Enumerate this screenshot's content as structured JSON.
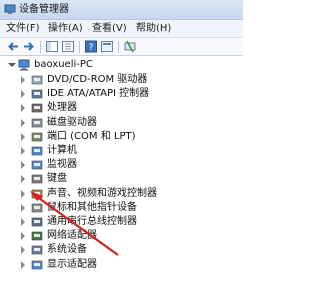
{
  "window": {
    "title": "设备管理器"
  },
  "menu": [
    {
      "label": "文件(F)"
    },
    {
      "label": "操作(A)"
    },
    {
      "label": "查看(V)"
    },
    {
      "label": "帮助(H)"
    }
  ],
  "toolbar": {
    "buttons": [
      "back-icon",
      "forward-icon",
      "show-hide-icon",
      "console-tree-icon",
      "help-icon",
      "properties-icon",
      "update-driver-icon"
    ]
  },
  "tree": {
    "root": "baoxueli-PC",
    "items": [
      {
        "label": "DVD/CD-ROM 驱动器",
        "icon": "dvd-drive-icon"
      },
      {
        "label": "IDE ATA/ATAPI 控制器",
        "icon": "ide-controller-icon"
      },
      {
        "label": "处理器",
        "icon": "processor-icon"
      },
      {
        "label": "磁盘驱动器",
        "icon": "disk-drive-icon"
      },
      {
        "label": "端口 (COM 和 LPT)",
        "icon": "port-icon"
      },
      {
        "label": "计算机",
        "icon": "computer-icon"
      },
      {
        "label": "监视器",
        "icon": "monitor-icon"
      },
      {
        "label": "键盘",
        "icon": "keyboard-icon"
      },
      {
        "label": "声音、视频和游戏控制器",
        "icon": "sound-icon"
      },
      {
        "label": "鼠标和其他指针设备",
        "icon": "mouse-icon"
      },
      {
        "label": "通用串行总线控制器",
        "icon": "usb-icon"
      },
      {
        "label": "网络适配器",
        "icon": "network-adapter-icon"
      },
      {
        "label": "系统设备",
        "icon": "system-device-icon"
      },
      {
        "label": "显示适配器",
        "icon": "display-adapter-icon"
      }
    ]
  },
  "annotation": {
    "color": "#d42020"
  }
}
